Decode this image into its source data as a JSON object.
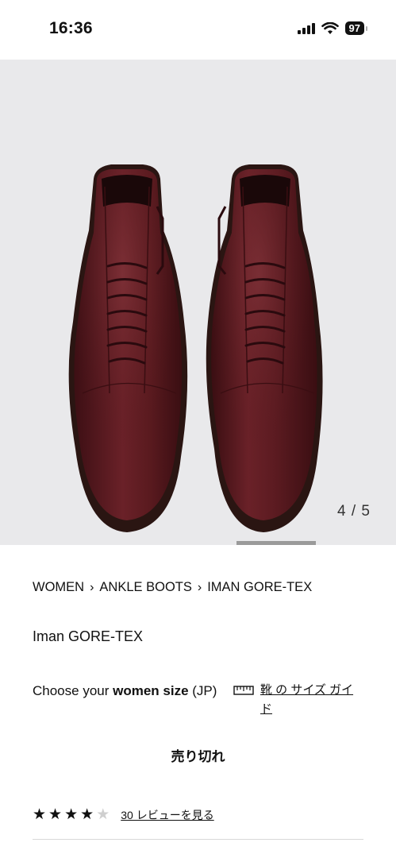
{
  "status_bar": {
    "time": "16:36",
    "battery": "97"
  },
  "product_image": {
    "counter": "4 / 5",
    "alt": "Iman GORE-TEX burgundy leather ankle boots, top view"
  },
  "breadcrumb": {
    "items": [
      "WOMEN",
      "ANKLE BOOTS",
      "IMAN GORE-TEX"
    ]
  },
  "product": {
    "title": "Iman GORE-TEX"
  },
  "size": {
    "label_prefix": "Choose your ",
    "label_bold": "women size",
    "label_suffix": " (JP)",
    "guide_link": "靴 の サイズ ガイド"
  },
  "availability": {
    "status": "売り切れ"
  },
  "reviews": {
    "rating": 4,
    "max_rating": 5,
    "link": "30 レビューを見る"
  },
  "colors": {
    "image_background": "#e9e9eb",
    "boot_leather": "#5a1a1f",
    "sole": "#2a1512"
  }
}
